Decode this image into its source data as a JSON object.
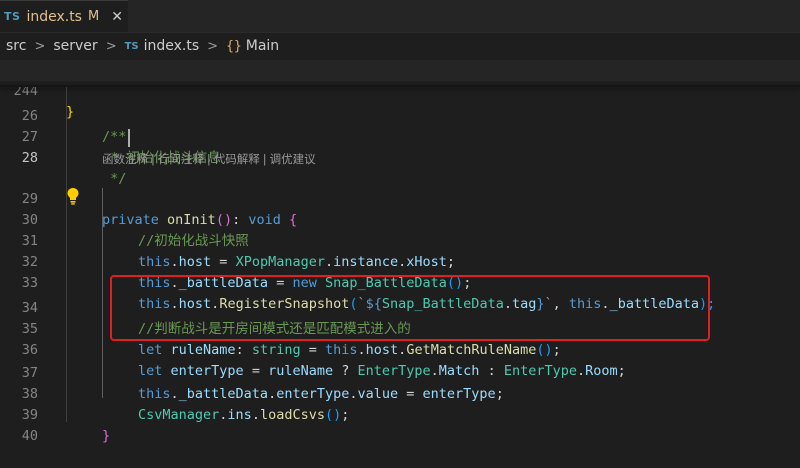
{
  "tab": {
    "badge": "TS",
    "name": "index.ts",
    "status": "M",
    "close": "✕"
  },
  "breadcrumb": {
    "items": [
      "src",
      "server"
    ],
    "file_badge": "TS",
    "file": "index.ts",
    "symbol_icon": "{}",
    "symbol": "Main",
    "separator": ">"
  },
  "sticky": {
    "line_number": "244",
    "code": "}"
  },
  "code_lens": {
    "items": [
      "函数注释",
      "行间注释",
      "代码解释",
      "调优建议"
    ],
    "separator": "|"
  },
  "lines": {
    "l26": {
      "n": "26",
      "t0": "/**"
    },
    "l27": {
      "n": "27",
      "t0": " * 初始化战斗信息"
    },
    "l28": {
      "n": "28",
      "t0": " */"
    },
    "l29": {
      "n": "29",
      "t0": "private ",
      "t1": "onInit",
      "t2": "(",
      "t3": ")",
      "t4": ": ",
      "t5": "void",
      "t6": " ",
      "t7": "{"
    },
    "l30": {
      "n": "30",
      "t0": "//初始化战斗快照"
    },
    "l31": {
      "n": "31",
      "t0": "this",
      "t1": ".",
      "t2": "host",
      "t3": " = ",
      "t4": "XPopManager",
      "t5": ".",
      "t6": "instance",
      "t7": ".",
      "t8": "xHost",
      "t9": ";"
    },
    "l32": {
      "n": "32",
      "t0": "this",
      "t1": ".",
      "t2": "_battleData",
      "t3": " = ",
      "t4": "new",
      "t5": " ",
      "t6": "Snap_BattleData",
      "t7": "(",
      "t8": ")",
      "t9": ";"
    },
    "l33": {
      "n": "33",
      "t0": "this",
      "t1": ".",
      "t2": "host",
      "t3": ".",
      "t4": "RegisterSnapshot",
      "t5": "(",
      "t6": "`",
      "t7": "${",
      "t8": "Snap_BattleData",
      "t9": ".",
      "t10": "tag",
      "t11": "}",
      "t12": "`",
      "t13": ", ",
      "t14": "this",
      "t15": ".",
      "t16": "_battleData",
      "t17": ");"
    },
    "l34": {
      "n": "34",
      "t0": "//判断战斗是开房间模式还是匹配模式进入的"
    },
    "l35": {
      "n": "35",
      "t0": "let",
      "t1": " ",
      "t2": "ruleName",
      "t3": ": ",
      "t4": "string",
      "t5": " = ",
      "t6": "this",
      "t7": ".",
      "t8": "host",
      "t9": ".",
      "t10": "GetMatchRuleName",
      "t11": "(",
      "t12": ")",
      "t13": ";"
    },
    "l36": {
      "n": "36",
      "t0": "let",
      "t1": " ",
      "t2": "enterType",
      "t3": " = ",
      "t4": "ruleName",
      "t5": " ? ",
      "t6": "EnterType",
      "t7": ".",
      "t8": "Match",
      "t9": " : ",
      "t10": "EnterType",
      "t11": ".",
      "t12": "Room",
      "t13": ";"
    },
    "l37": {
      "n": "37",
      "t0": "this",
      "t1": ".",
      "t2": "_battleData",
      "t3": ".",
      "t4": "enterType",
      "t5": ".",
      "t6": "value",
      "t7": " = ",
      "t8": "enterType",
      "t9": ";"
    },
    "l38": {
      "n": "38",
      "t0": "CsvManager",
      "t1": ".",
      "t2": "ins",
      "t3": ".",
      "t4": "loadCsvs",
      "t5": "(",
      "t6": ")",
      "t7": ";"
    },
    "l39": {
      "n": "39",
      "t0": "}"
    },
    "l40": {
      "n": "40"
    }
  },
  "colors": {
    "highlight_box": "#e02020",
    "lightbulb": "#ffcc00",
    "editor_bg": "#1e1e1e"
  }
}
